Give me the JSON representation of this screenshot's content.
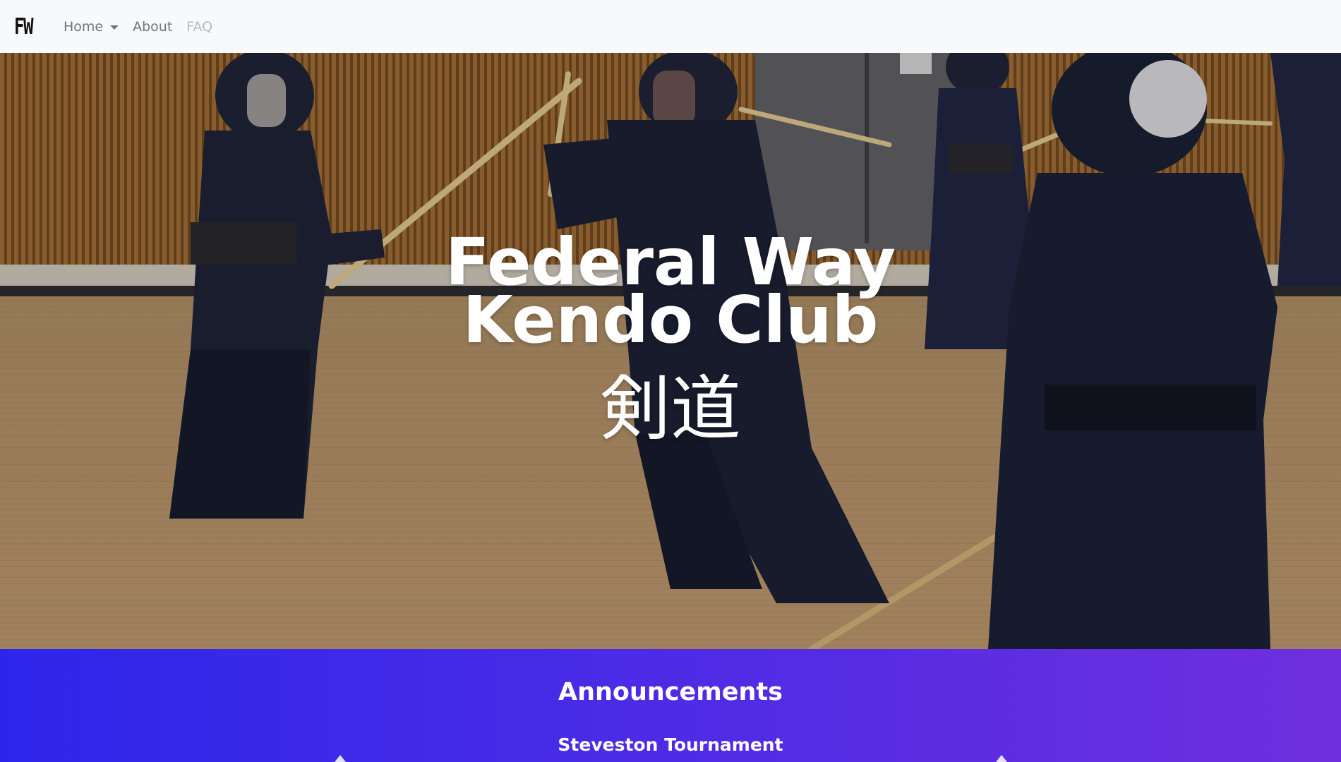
{
  "navbar": {
    "brand": "FW",
    "items": [
      {
        "label": "Home",
        "has_dropdown": true
      },
      {
        "label": "About"
      },
      {
        "label": "FAQ",
        "disabled": true
      }
    ],
    "background_color": "#f8f9fa"
  },
  "hero": {
    "title_line1": "Federal Way",
    "title_line2": "Kendo Club",
    "subtitle": "剣道",
    "background_image": "photo of kendo practitioners in bogu armor sparring with shinai in a wooden-floored gym"
  },
  "announcements": {
    "heading": "Announcements",
    "items": [
      {
        "title": "Steveston Tournament"
      }
    ],
    "gradient": [
      "#2d26ea",
      "#6f2fde"
    ]
  }
}
